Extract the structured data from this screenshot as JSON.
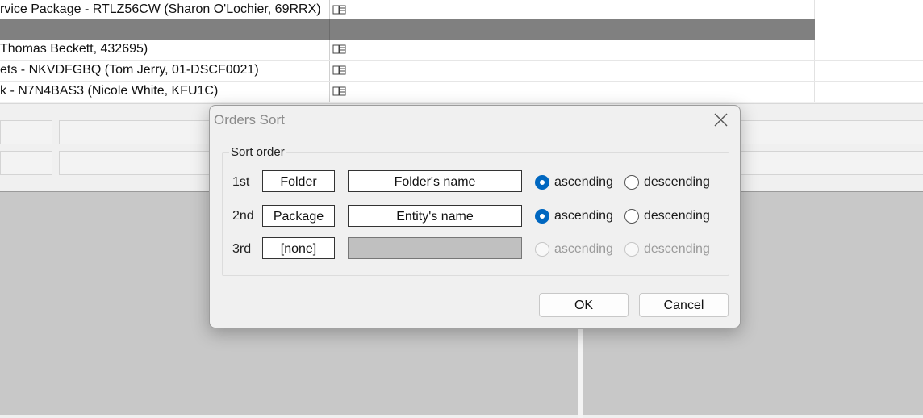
{
  "list": {
    "rows": [
      {
        "text": "rvice Package - RTLZ56CW (Sharon  O'Lochier, 69RRX)",
        "icon": "package-icon",
        "selected": false
      },
      {
        "text": "",
        "icon": "",
        "selected": true
      },
      {
        "text": "Thomas  Beckett, 432695)",
        "icon": "package-icon",
        "selected": false
      },
      {
        "text": "ets - NKVDFGBQ (Tom  Jerry, 01-DSCF0021)",
        "icon": "package-icon",
        "selected": false
      },
      {
        "text": "k - N7N4BAS3 (Nicole  White, KFU1C)",
        "icon": "package-icon",
        "selected": false
      }
    ]
  },
  "dialog": {
    "title": "Orders Sort",
    "close_icon": "close-icon",
    "group_label": "Sort order",
    "rows": [
      {
        "ordinal": "1st",
        "field": "Folder",
        "name": "Folder's name",
        "ascending": "ascending",
        "descending": "descending",
        "selected": "ascending",
        "enabled": true
      },
      {
        "ordinal": "2nd",
        "field": "Package",
        "name": "Entity's name",
        "ascending": "ascending",
        "descending": "descending",
        "selected": "ascending",
        "enabled": true
      },
      {
        "ordinal": "3rd",
        "field": "[none]",
        "name": "",
        "ascending": "ascending",
        "descending": "descending",
        "selected": "",
        "enabled": false
      }
    ],
    "ok_label": "OK",
    "cancel_label": "Cancel"
  },
  "colors": {
    "accent": "#0067c0",
    "selected_row": "#808080"
  }
}
